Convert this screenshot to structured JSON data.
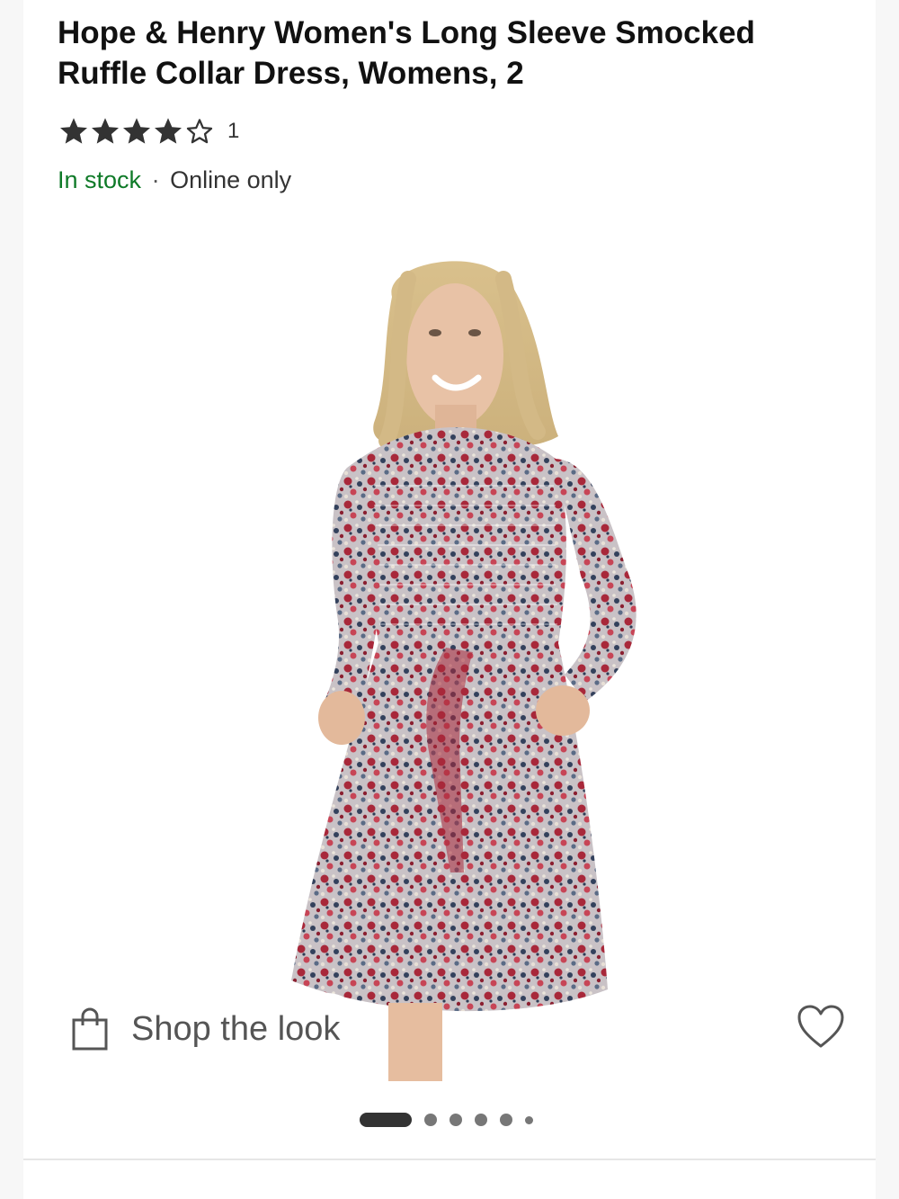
{
  "product": {
    "title": "Hope & Henry Women's Long Sleeve Smocked Ruffle Collar Dress, Womens, 2",
    "rating": 4,
    "rating_max": 5,
    "review_count": "1",
    "stock_status": "In stock",
    "separator": "·",
    "availability": "Online only",
    "image": {
      "alt": "Model wearing floral smocked long sleeve dress with tie belt"
    }
  },
  "actions": {
    "shop_the_look": "Shop the look",
    "bag_icon": "shopping-bag-icon",
    "favorite_icon": "heart-icon"
  },
  "carousel": {
    "total": 6,
    "active_index": 0
  },
  "colors": {
    "in_stock": "#0f7a28",
    "text": "#111111",
    "star": "#333333",
    "dress_red": "#a8283a",
    "dress_navy": "#33415c"
  }
}
